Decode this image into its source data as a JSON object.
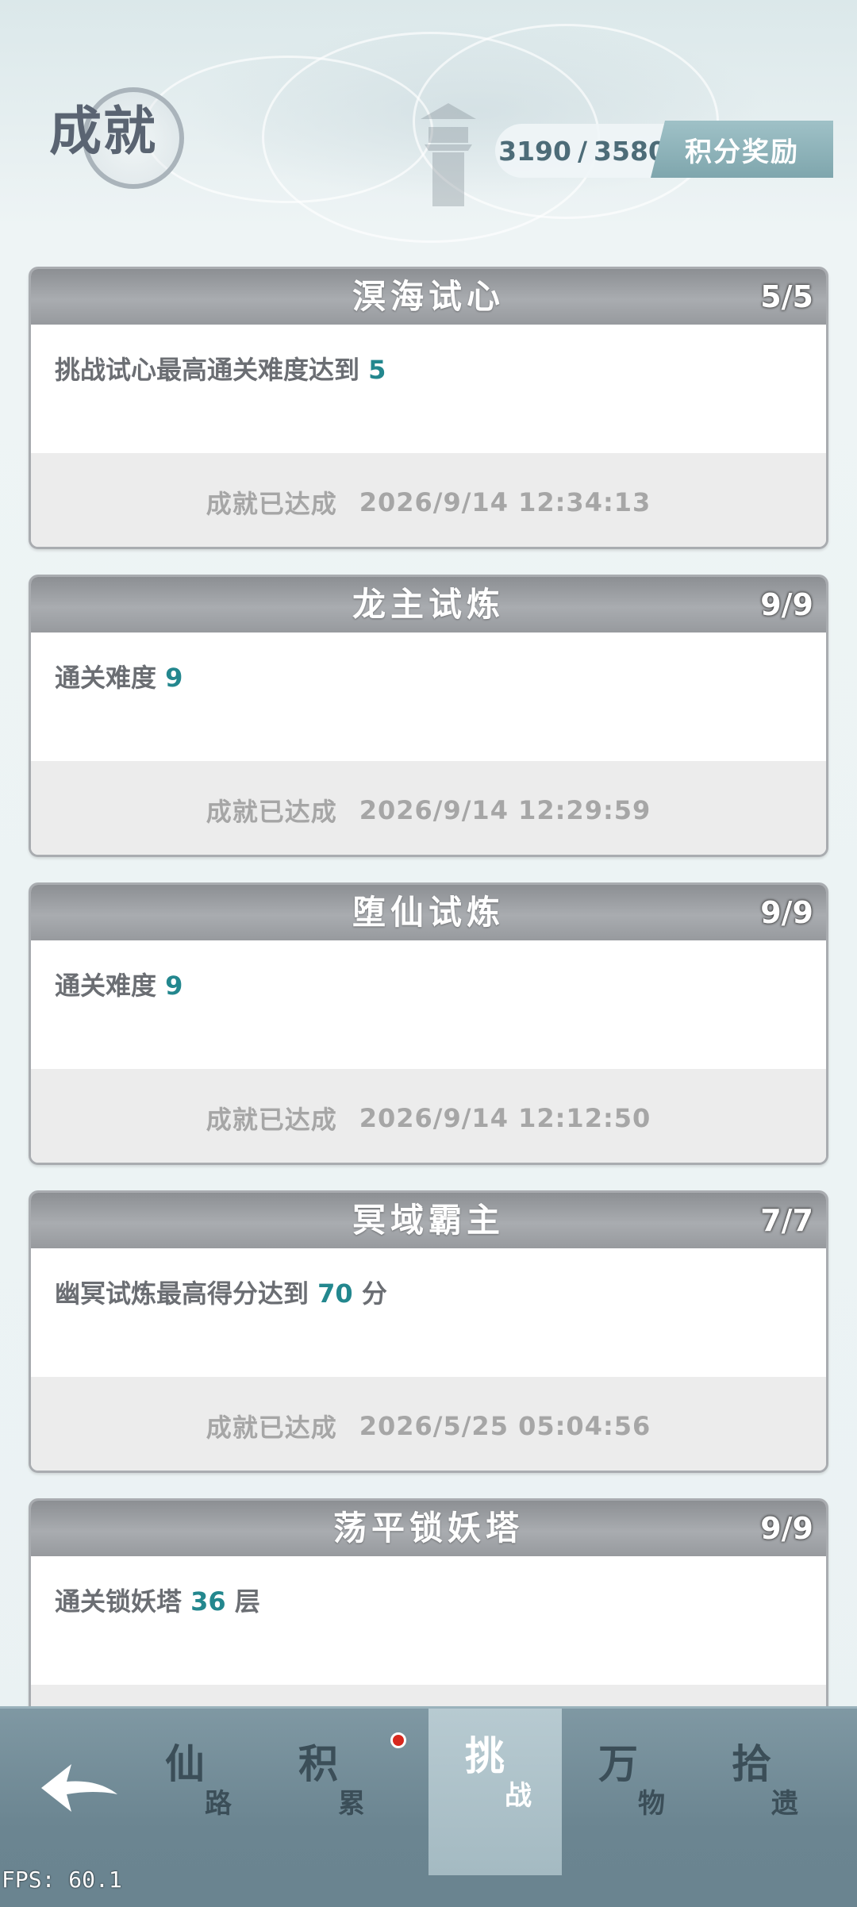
{
  "header": {
    "title": "成就",
    "score_current": "3190",
    "score_separator": "/",
    "score_total": "3580",
    "reward_button": "积分奖励"
  },
  "achievements": [
    {
      "title": "溟海试心",
      "count": "5/5",
      "desc_prefix": "挑战试心最高通关难度达到 ",
      "desc_value": "5",
      "desc_suffix": "",
      "status": "成就已达成",
      "timestamp": "2026/9/14 12:34:13"
    },
    {
      "title": "龙主试炼",
      "count": "9/9",
      "desc_prefix": "通关难度 ",
      "desc_value": "9",
      "desc_suffix": "",
      "status": "成就已达成",
      "timestamp": "2026/9/14 12:29:59"
    },
    {
      "title": "堕仙试炼",
      "count": "9/9",
      "desc_prefix": "通关难度 ",
      "desc_value": "9",
      "desc_suffix": "",
      "status": "成就已达成",
      "timestamp": "2026/9/14 12:12:50"
    },
    {
      "title": "冥域霸主",
      "count": "7/7",
      "desc_prefix": "幽冥试炼最高得分达到 ",
      "desc_value": "70",
      "desc_suffix": " 分",
      "status": "成就已达成",
      "timestamp": "2026/5/25 05:04:56"
    },
    {
      "title": "荡平锁妖塔",
      "count": "9/9",
      "desc_prefix": "通关锁妖塔 ",
      "desc_value": "36",
      "desc_suffix": " 层",
      "status": "",
      "timestamp": ""
    }
  ],
  "nav": {
    "back_icon": "back-arrow-icon",
    "items": [
      {
        "big": "仙",
        "small": "路"
      },
      {
        "big": "积",
        "small": "累"
      },
      {
        "big": "挑",
        "small": "战"
      },
      {
        "big": "万",
        "small": "物"
      },
      {
        "big": "拾",
        "small": "遗"
      }
    ]
  },
  "colors": {
    "highlight": "#23878e",
    "notification_dot": "#d8281e",
    "active_tab": "#b7cad1"
  },
  "debug": {
    "fps": "FPS: 60.1"
  }
}
